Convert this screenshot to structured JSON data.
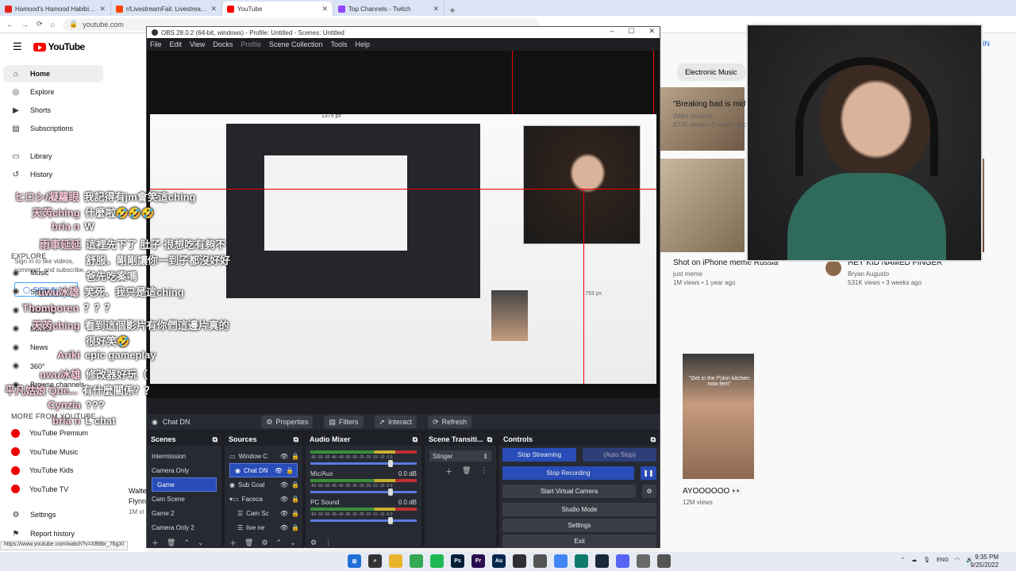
{
  "browser": {
    "tabs": [
      {
        "label": "Hamood's Hamood Habibi Offic...",
        "color": "#e62117"
      },
      {
        "label": "r/LivestreamFail: Livestream vir...",
        "color": "#ff4500"
      },
      {
        "label": "YouTube",
        "color": "#ff0000"
      },
      {
        "label": "Top Channels - Twitch",
        "color": "#9146ff"
      }
    ],
    "url": "youtube.com",
    "status_url": "https://www.youtube.com/watch?v=XB8br_76gXI"
  },
  "youtube": {
    "logo": "YouTube",
    "sidebar": [
      {
        "label": "Home",
        "icon": "home-icon"
      },
      {
        "label": "Explore",
        "icon": "compass-icon"
      },
      {
        "label": "Shorts",
        "icon": "shorts-icon"
      },
      {
        "label": "Subscriptions",
        "icon": "subscriptions-icon"
      },
      {
        "label": "Library",
        "icon": "library-icon"
      },
      {
        "label": "History",
        "icon": "history-icon"
      }
    ],
    "signin_note": "Sign in to like videos, comment, and subscribe.",
    "signin_label": "SIGN IN",
    "explore_heading": "EXPLORE",
    "explore": [
      {
        "label": "Music"
      },
      {
        "label": "Sports"
      },
      {
        "label": "Gaming"
      },
      {
        "label": "Movies"
      },
      {
        "label": "News"
      },
      {
        "label": "360°"
      },
      {
        "label": "Browse channels"
      }
    ],
    "more_heading": "MORE FROM YOUTUBE",
    "more": [
      {
        "label": "YouTube Premium"
      },
      {
        "label": "YouTube Music"
      },
      {
        "label": "YouTube Kids"
      },
      {
        "label": "YouTube TV"
      }
    ],
    "settings": "Settings",
    "report": "Report history",
    "chip": "Electronic Music",
    "signin_top": "IN",
    "videos": [
      {
        "title": "\"Breaking bad is mid\"",
        "channel": "(Mike studios)",
        "meta": "877K views • 3 weeks ago"
      },
      {
        "title": "Shot on iPhone meme Russia",
        "channel": "just meme",
        "meta": "1M views • 1 year ago"
      },
      {
        "title": "HEY KID NAMED FINGER",
        "channel": "Bryan Augusto",
        "meta": "531K views • 3 weeks ago"
      },
      {
        "title": "AYOOOOOO 👀",
        "channel": "",
        "meta": "12M views",
        "caption": "\"Get in the f*ckin kitchen now fem\""
      }
    ],
    "partial_left": {
      "title": "Walte",
      "title2": "Flynn",
      "meta": "1M vi"
    }
  },
  "obs": {
    "title": "OBS 28.0.2 (64-bit, windows) - Profile: Untitled - Scenes: Untitled",
    "menu": [
      "File",
      "Edit",
      "View",
      "Docks",
      "Profile",
      "Scene Collection",
      "Tools",
      "Help"
    ],
    "source_name": "Chat DN",
    "source_buttons": [
      "Properties",
      "Filters",
      "Interact",
      "Refresh"
    ],
    "measure_top": "1375 px",
    "measure_right": "793 px",
    "scenes_title": "Scenes",
    "scenes": [
      "Intermission",
      "Camera Only",
      "Game",
      "Cam Scene",
      "Game 2",
      "Camera Only 2"
    ],
    "selected_scene": "Game",
    "sources_title": "Sources",
    "sources": [
      {
        "name": "Window C"
      },
      {
        "name": "Chat DN"
      },
      {
        "name": "Sub Goal"
      },
      {
        "name": "Faceca"
      },
      {
        "name": "Cam Sc"
      },
      {
        "name": "live ne"
      }
    ],
    "mixer_title": "Audio Mixer",
    "mixer": [
      {
        "name": "",
        "db": ""
      },
      {
        "name": "Mic/Aux",
        "db": "0.0 dB"
      },
      {
        "name": "PC Sound",
        "db": "0.0 dB"
      }
    ],
    "meter_scale": "-60 -55 -50 -45 -40 -35 -30 -25 -20 -15 -10 -5 0",
    "transitions_title": "Scene Transiti...",
    "transition": "Stinger",
    "controls_title": "Controls",
    "controls": {
      "stop_streaming": "Stop Streaming",
      "auto_stop": "(Auto Stop)",
      "stop_recording": "Stop Recording",
      "virtual_camera": "Start Virtual Camera",
      "studio_mode": "Studio Mode",
      "settings": "Settings",
      "exit": "Exit"
    }
  },
  "chat": [
    {
      "user": "ヒロシ/凝蘿眼",
      "msg": "我記得有jm會笑這ching"
    },
    {
      "user": "天芮ching",
      "msg": "什麼啦🤣🤣🤣"
    },
    {
      "user": "bria n",
      "msg": "W"
    },
    {
      "user": "雨車延延",
      "msg": "這裡先下了 肚子 很想吃有夠不"
    },
    {
      "user": "",
      "msg": "舒服、剛剛讓你一到子都沒好好"
    },
    {
      "user": "",
      "msg": "爸先吃案嗎"
    },
    {
      "user": "uwu冰雄",
      "msg": "笑死、我只是這ching"
    },
    {
      "user": "Thomboren",
      "msg": "？？？"
    },
    {
      "user": "天芮ching",
      "msg": "看到這個影片有你們這邊片真的"
    },
    {
      "user": "",
      "msg": "很好笑🤣"
    },
    {
      "user": "Ariki",
      "msg": "epic gameplay"
    },
    {
      "user": "uwu冰雄",
      "msg": "修改器好玩（"
    },
    {
      "user": "平凡姑娘 Que...",
      "msg": "有什麼關係？？"
    },
    {
      "user": "Cynzia",
      "msg": "???"
    },
    {
      "user": "bria n",
      "msg": "L chat"
    }
  ],
  "taskbar": {
    "apps": [
      {
        "icon": "windows-icon",
        "label": "",
        "color": "#1f6fd6"
      },
      {
        "icon": "search-icon",
        "label": "",
        "color": "#333333"
      },
      {
        "icon": "files-icon",
        "label": "",
        "color": "#e8b42a"
      },
      {
        "icon": "chrome-icon",
        "label": "",
        "color": "#34a853"
      },
      {
        "icon": "spotify-icon",
        "label": "",
        "color": "#1db954"
      },
      {
        "icon": "photoshop-icon",
        "label": "Ps",
        "color": "#001e36"
      },
      {
        "icon": "premiere-icon",
        "label": "Pr",
        "color": "#2a0c4e"
      },
      {
        "icon": "audition-icon",
        "label": "Au",
        "color": "#00264d"
      },
      {
        "icon": "obs-icon",
        "label": "",
        "color": "#302e31"
      },
      {
        "icon": "app-icon",
        "label": "",
        "color": "#555555"
      },
      {
        "icon": "chrome2-icon",
        "label": "",
        "color": "#4285f4"
      },
      {
        "icon": "app2-icon",
        "label": "",
        "color": "#0f7b6c"
      },
      {
        "icon": "steam-icon",
        "label": "",
        "color": "#1b2838"
      },
      {
        "icon": "discord-icon",
        "label": "",
        "color": "#5865f2"
      },
      {
        "icon": "notepad-icon",
        "label": "",
        "color": "#6a6a6a"
      },
      {
        "icon": "settings-icon",
        "label": "",
        "color": "#555555"
      }
    ],
    "lang": "ENG",
    "time": "9:35 PM",
    "date": "9/25/2022"
  }
}
